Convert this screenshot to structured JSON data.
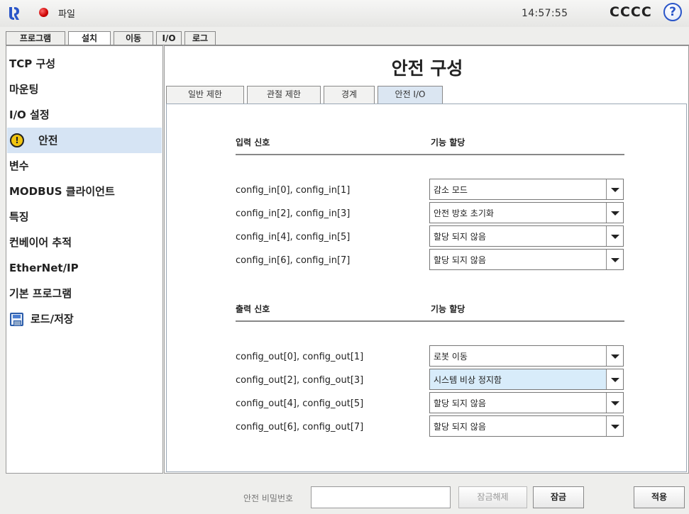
{
  "topbar": {
    "file_menu": "파일",
    "clock": "14:57:55",
    "robot_name": "CCCC",
    "help_symbol": "?"
  },
  "main_tabs": [
    {
      "label": "프로그램",
      "active": false
    },
    {
      "label": "설치",
      "active": true
    },
    {
      "label": "이동",
      "active": false
    },
    {
      "label": "I/O",
      "active": false
    },
    {
      "label": "로그",
      "active": false
    }
  ],
  "sidebar": {
    "items": [
      {
        "label": "TCP 구성",
        "icon": null
      },
      {
        "label": "마운팅",
        "icon": null
      },
      {
        "label": "I/O 설정",
        "icon": null
      },
      {
        "label": "안전",
        "icon": "warning-icon",
        "selected": true,
        "icon_glyph": "!"
      },
      {
        "label": "변수",
        "icon": null
      },
      {
        "label": "MODBUS 클라이언트",
        "icon": null
      },
      {
        "label": "특징",
        "icon": null
      },
      {
        "label": "컨베이어 추적",
        "icon": null
      },
      {
        "label": "EtherNet/IP",
        "icon": null
      },
      {
        "label": "기본 프로그램",
        "icon": null
      },
      {
        "label": "로드/저장",
        "icon": "floppy-disk-icon"
      }
    ]
  },
  "content": {
    "title": "안전 구성",
    "sub_tabs": [
      {
        "label": "일반 제한",
        "active": false
      },
      {
        "label": "관절 제한",
        "active": false
      },
      {
        "label": "경계",
        "active": false
      },
      {
        "label": "안전 I/O",
        "active": true
      }
    ],
    "inputs": {
      "signal_header": "입력 신호",
      "function_header": "기능 할당",
      "rows": [
        {
          "signal": "config_in[0], config_in[1]",
          "function": "감소 모드"
        },
        {
          "signal": "config_in[2], config_in[3]",
          "function": "안전 방호 초기화"
        },
        {
          "signal": "config_in[4], config_in[5]",
          "function": "할당 되지 않음"
        },
        {
          "signal": "config_in[6], config_in[7]",
          "function": "할당 되지 않음"
        }
      ]
    },
    "outputs": {
      "signal_header": "출력 신호",
      "function_header": "기능 할당",
      "rows": [
        {
          "signal": "config_out[0], config_out[1]",
          "function": "로봇 이동"
        },
        {
          "signal": "config_out[2], config_out[3]",
          "function": "시스템 비상 정지함",
          "highlighted": true
        },
        {
          "signal": "config_out[4], config_out[5]",
          "function": "할당 되지 않음"
        },
        {
          "signal": "config_out[6], config_out[7]",
          "function": "할당 되지 않음"
        }
      ]
    }
  },
  "bottom": {
    "password_label": "안전 비밀번호",
    "password_value": "",
    "unlock_label": "잠금해제",
    "lock_label": "잠금",
    "apply_label": "적용"
  },
  "colors": {
    "selection": "#d6e4f4",
    "highlight_dropdown": "#d8ecfa",
    "status_dot": "#cc0000",
    "help_icon": "#2a55c8",
    "warning_icon": "#f1c40f"
  }
}
